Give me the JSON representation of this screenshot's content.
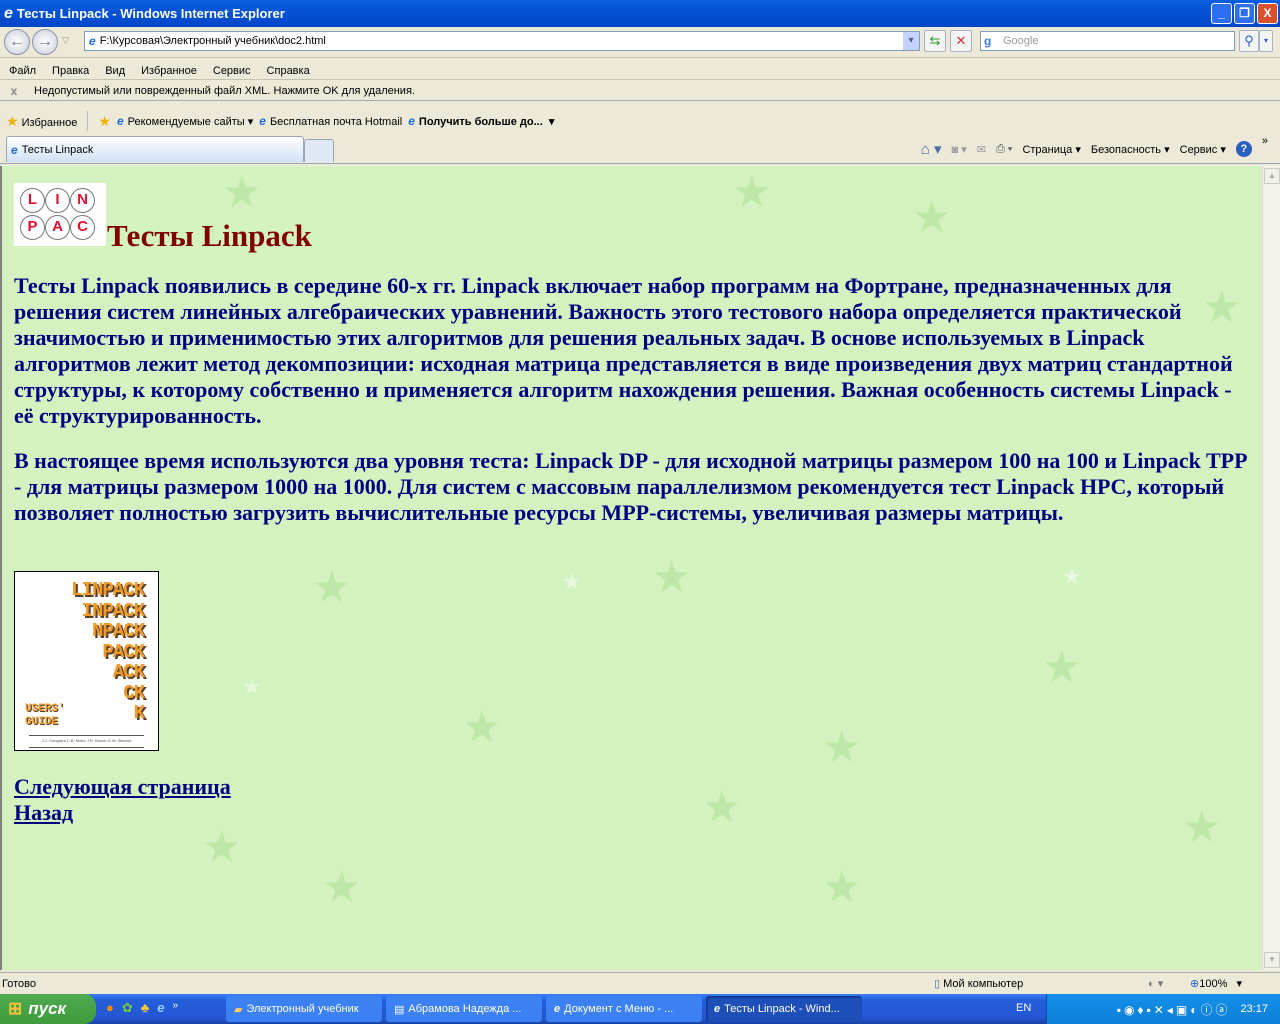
{
  "window": {
    "title": "Тесты Linpack - Windows Internet Explorer",
    "minimize": "_",
    "restore": "❐",
    "close": "X"
  },
  "address": {
    "url": "F:\\Курсовая\\Электронный учебник\\doc2.html"
  },
  "search": {
    "placeholder": "Google"
  },
  "menu": [
    "Файл",
    "Правка",
    "Вид",
    "Избранное",
    "Сервис",
    "Справка"
  ],
  "infobar": {
    "close": "x",
    "message": "Недопустимый или поврежденный файл XML. Нажмите OK для удаления."
  },
  "favorites": {
    "label": "Избранное",
    "items": [
      "Рекомендуемые сайты",
      "Бесплатная почта Hotmail",
      "Получить больше до..."
    ]
  },
  "tab": {
    "label": "Тесты Linpack"
  },
  "commands": {
    "page": "Страница",
    "safety": "Безопасность",
    "tools": "Сервис",
    "more": "»"
  },
  "page": {
    "logo_letters": [
      "L",
      "I",
      "N",
      "P",
      "A",
      "C"
    ],
    "heading": "Тесты Linpack",
    "paragraphs": [
      "Тесты Linpack появились в середине 60-х гг. Linpack включает набор программ на Фортране, предназначенных для решения систем линейных алгебраических уравнений. Важность этого тестового набора определяется практической значимостью и применимостью этих алгоритмов для решения реальных задач. В основе используемых в Linpack алгоритмов лежит метод декомпозиции: исходная матрица представляется в виде произведения двух матриц стандартной структуры, к которому собственно и применяется алгоритм нахождения решения. Важная особенность системы Linpack - её структурированность.",
      "В настоящее время используются два уровня теста: Linpack DP - для исходной матрицы размером 100 на 100 и Linpack TPP - для матрицы размером 1000 на 1000. Для систем с массовым параллелизмом рекомендуется тест Linpack HPC, который позволяет полностью загрузить вычислительные ресурсы MPP-системы, увеличивая размеры матрицы."
    ],
    "book_lines": [
      "LINPACK",
      "INPACK",
      "NPACK",
      "PACK",
      "ACK",
      "CK",
      "K"
    ],
    "book_subtitle": [
      "USERS'",
      "GUIDE"
    ],
    "book_authors": "J.J. Dongarra  C.B. Moler  J.R. Bunch  G.W. Stewart",
    "next_link": "Следующая страница",
    "back_link": "Назад"
  },
  "status": {
    "text": "Готово",
    "zone": "Мой компьютер",
    "zoom": "100%"
  },
  "taskbar": {
    "start": "пуск",
    "tasks": [
      "Электронный учебник",
      "Абрамова Надежда ...",
      "Документ с Меню - ...",
      "Тесты Linpack - Wind..."
    ],
    "lang": "EN",
    "clock": "23:17"
  }
}
